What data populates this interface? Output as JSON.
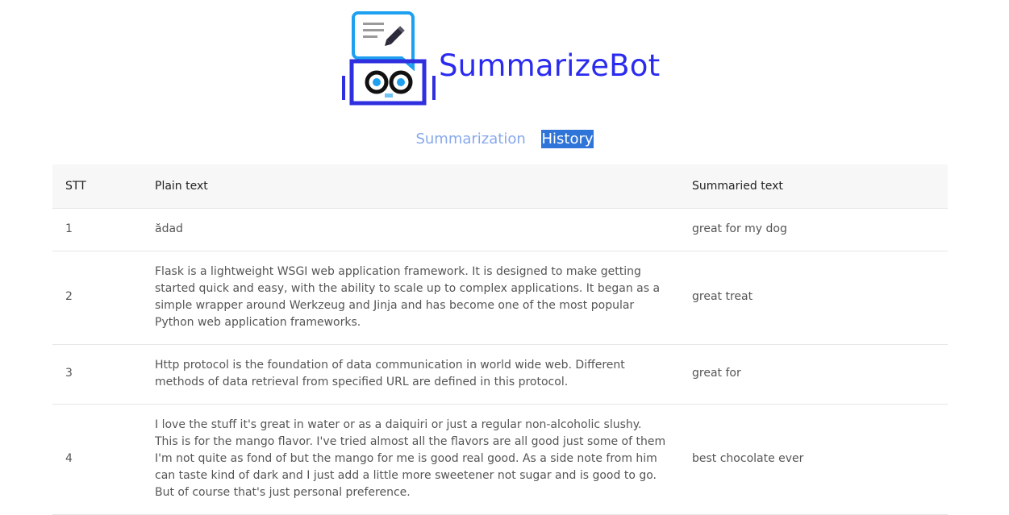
{
  "brand": {
    "name": "SummarizeBot",
    "logo": "robot-speech-bubble-pencil-icon"
  },
  "nav": {
    "summarization": "Summarization",
    "history": "History",
    "active": "History"
  },
  "table": {
    "headers": {
      "stt": "STT",
      "plain": "Plain text",
      "summaried": "Summaried text"
    },
    "rows": [
      {
        "stt": "1",
        "plain": "ădad",
        "summaried": "great for my dog"
      },
      {
        "stt": "2",
        "plain": "Flask is a lightweight WSGI web application framework. It is designed to make getting started quick and easy, with the ability to scale up to complex applications. It began as a simple wrapper around Werkzeug and Jinja and has become one of the most popular Python web application frameworks.",
        "summaried": "great treat"
      },
      {
        "stt": "3",
        "plain": "Http protocol is the foundation of data communication in world wide web. Different methods of data retrieval from specified URL are defined in this protocol.",
        "summaried": "great for"
      },
      {
        "stt": "4",
        "plain": "I love the stuff it's great in water or as a daiquiri or just a regular non-alcoholic slushy. This is for the mango flavor. I've tried almost all the flavors are all good just some of them I'm not quite as fond of but the mango for me is good real good. As a side note from him can taste kind of dark and I just add a little more sweetener not sugar and is good to go. But of course that's just personal preference.",
        "summaried": "best chocolate ever"
      }
    ]
  },
  "colors": {
    "brand": "#2b2bf0",
    "bubble": "#1ea0f0",
    "nav_inactive": "#86a8ec",
    "nav_active_bg": "#2f74d8"
  }
}
